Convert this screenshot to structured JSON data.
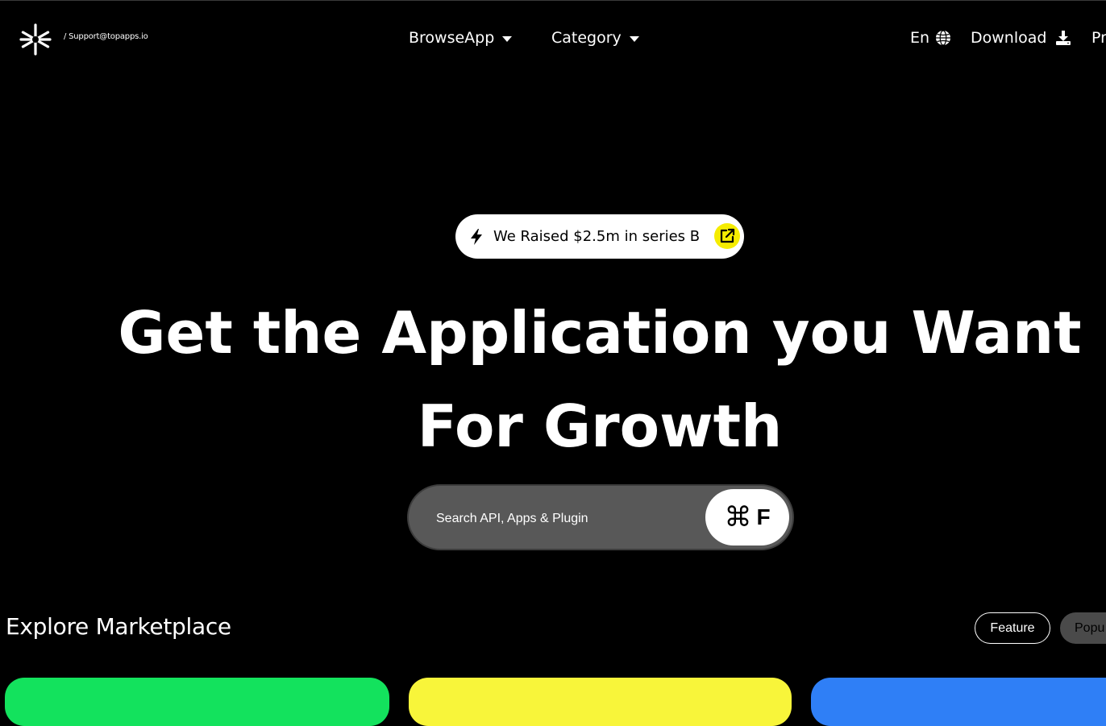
{
  "header": {
    "logo_icon": "asterisk-logo-icon",
    "support_text": "/ Support@topapps.io",
    "nav": {
      "browse_label": "BrowseApp",
      "category_label": "Category",
      "language_label": "En",
      "language_icon": "globe-icon",
      "download_label": "Download",
      "download_icon": "download-icon",
      "cut_label": "Pr"
    }
  },
  "hero": {
    "announcement": {
      "icon": "lightning-icon",
      "text": "We Raised $2.5m in series B",
      "link_icon": "external-link-icon",
      "accent": "#f5ec00"
    },
    "title_line1": "Get the Application you Want",
    "title_line2": "For Growth"
  },
  "search": {
    "placeholder": "Search API, Apps & Plugin",
    "shortcut_symbol": "⌘",
    "shortcut_key": "F"
  },
  "marketplace": {
    "title": "Explore Marketplace",
    "filters": [
      "Feature",
      "Popu"
    ],
    "card_colors": [
      "#13e25d",
      "#f8f53a",
      "#2f7ff6"
    ]
  }
}
